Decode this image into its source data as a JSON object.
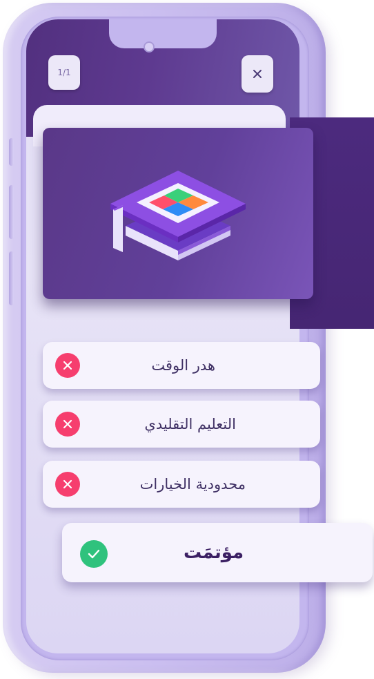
{
  "header": {
    "page_counter": "1/1",
    "close_icon": "close-icon"
  },
  "hero": {
    "icon": "graduation-cap-apps-icon",
    "tile_colors": [
      "#ff4f6b",
      "#3ad07a",
      "#ff8a3d",
      "#2f8cf5"
    ]
  },
  "options": [
    {
      "label": "هدر الوقت",
      "status": "wrong",
      "icon": "x-circle-icon"
    },
    {
      "label": "التعليم التقليدي",
      "status": "wrong",
      "icon": "x-circle-icon"
    },
    {
      "label": "محدودية الخيارات",
      "status": "wrong",
      "icon": "x-circle-icon"
    }
  ],
  "answer": {
    "label": "مؤتمَت",
    "status": "correct",
    "icon": "check-circle-icon"
  },
  "colors": {
    "accent": "#5a3888",
    "wrong": "#f63e6e",
    "correct": "#2fc27d"
  }
}
